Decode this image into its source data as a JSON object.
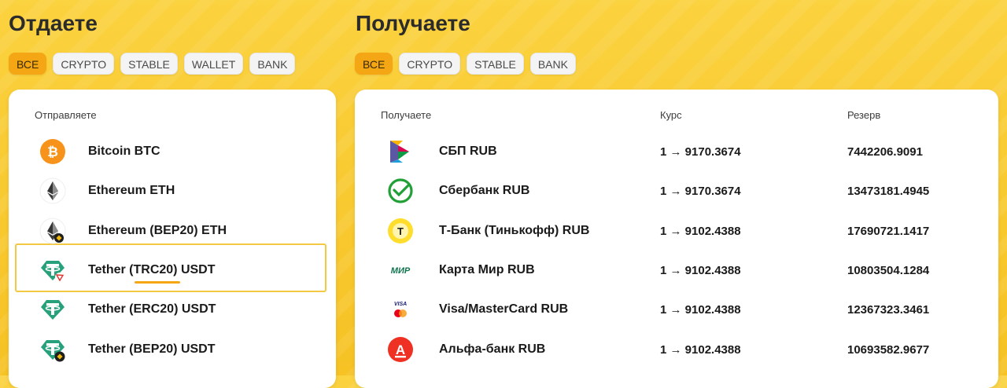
{
  "give": {
    "title": "Отдаете",
    "filters": [
      "ВСЕ",
      "CRYPTO",
      "STABLE",
      "WALLET",
      "BANK"
    ],
    "active_filter": "ВСЕ",
    "column_header": "Отправляете",
    "selected_index": 3,
    "items": [
      {
        "name": "Bitcoin BTC",
        "icon": "bitcoin-icon"
      },
      {
        "name": "Ethereum ETH",
        "icon": "ethereum-icon"
      },
      {
        "name": "Ethereum (BEP20) ETH",
        "icon": "ethereum-bep20-icon"
      },
      {
        "name": "Tether (TRC20) USDT",
        "icon": "tether-trc20-icon"
      },
      {
        "name": "Tether (ERC20) USDT",
        "icon": "tether-erc20-icon"
      },
      {
        "name": "Tether (BEP20) USDT",
        "icon": "tether-bep20-icon"
      }
    ]
  },
  "receive": {
    "title": "Получаете",
    "filters": [
      "ВСЕ",
      "CRYPTO",
      "STABLE",
      "BANK"
    ],
    "active_filter": "ВСЕ",
    "headers": {
      "name": "Получаете",
      "rate": "Курс",
      "reserve": "Резерв"
    },
    "items": [
      {
        "name": "СБП RUB",
        "rate": "1 → 9170.3674",
        "reserve": "7442206.9091",
        "icon": "sbp-icon"
      },
      {
        "name": "Сбербанк RUB",
        "rate": "1 → 9170.3674",
        "reserve": "13473181.4945",
        "icon": "sberbank-icon"
      },
      {
        "name": "Т-Банк (Тинькофф) RUB",
        "rate": "1 → 9102.4388",
        "reserve": "17690721.1417",
        "icon": "tbank-icon"
      },
      {
        "name": "Карта Мир RUB",
        "rate": "1 → 9102.4388",
        "reserve": "10803504.1284",
        "icon": "mir-icon"
      },
      {
        "name": "Visa/MasterCard RUB",
        "rate": "1 → 9102.4388",
        "reserve": "12367323.3461",
        "icon": "visa-mastercard-icon"
      },
      {
        "name": "Альфа-банк RUB",
        "rate": "1 → 9102.4388",
        "reserve": "10693582.9677",
        "icon": "alfabank-icon"
      }
    ],
    "icon_texts": {
      "tbank": "Т",
      "mir": "МИР",
      "visa": "VISA",
      "alfa": "А"
    }
  },
  "colors": {
    "accent": "#f4a615",
    "background": "#f8c82d",
    "bitcoin": "#f7931a",
    "tether": "#26a17b",
    "sberbank": "#21a038",
    "alfabank": "#ef3124",
    "tbank": "#ffdd2d"
  }
}
